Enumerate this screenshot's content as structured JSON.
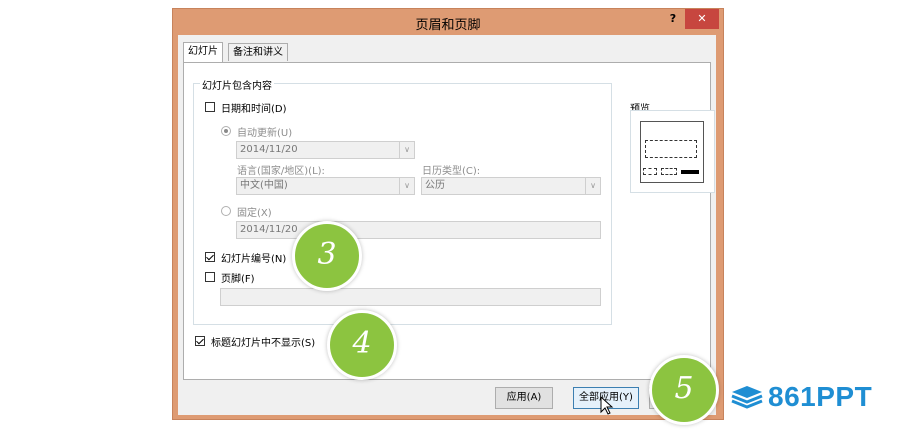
{
  "dialog": {
    "title": "页眉和页脚",
    "help": "?",
    "close": "✕",
    "tabs": [
      "幻灯片",
      "备注和讲义"
    ],
    "group_title": "幻灯片包含内容",
    "date_time": {
      "label": "日期和时间(D)",
      "checked": false
    },
    "auto_update": {
      "label": "自动更新(U)",
      "value": "2014/11/20"
    },
    "language": {
      "label": "语言(国家/地区)(L):",
      "value": "中文(中国)"
    },
    "calendar": {
      "label": "日历类型(C):",
      "value": "公历"
    },
    "fixed": {
      "label": "固定(X)",
      "value": "2014/11/20"
    },
    "slide_number": {
      "label": "幻灯片编号(N)",
      "checked": true
    },
    "footer": {
      "label": "页脚(F)",
      "checked": false,
      "value": ""
    },
    "title_slide": {
      "label": "标题幻灯片中不显示(S)",
      "checked": true
    },
    "preview_label": "预览",
    "buttons": {
      "apply": "应用(A)",
      "apply_all": "全部应用(Y)"
    }
  },
  "badges": [
    "3",
    "4",
    "5"
  ],
  "logo": {
    "text": "861PPT"
  },
  "colors": {
    "titlebar": "#de9b73",
    "close": "#c7463f",
    "badge": "#8cc440",
    "logo": "#1f8ed3"
  }
}
